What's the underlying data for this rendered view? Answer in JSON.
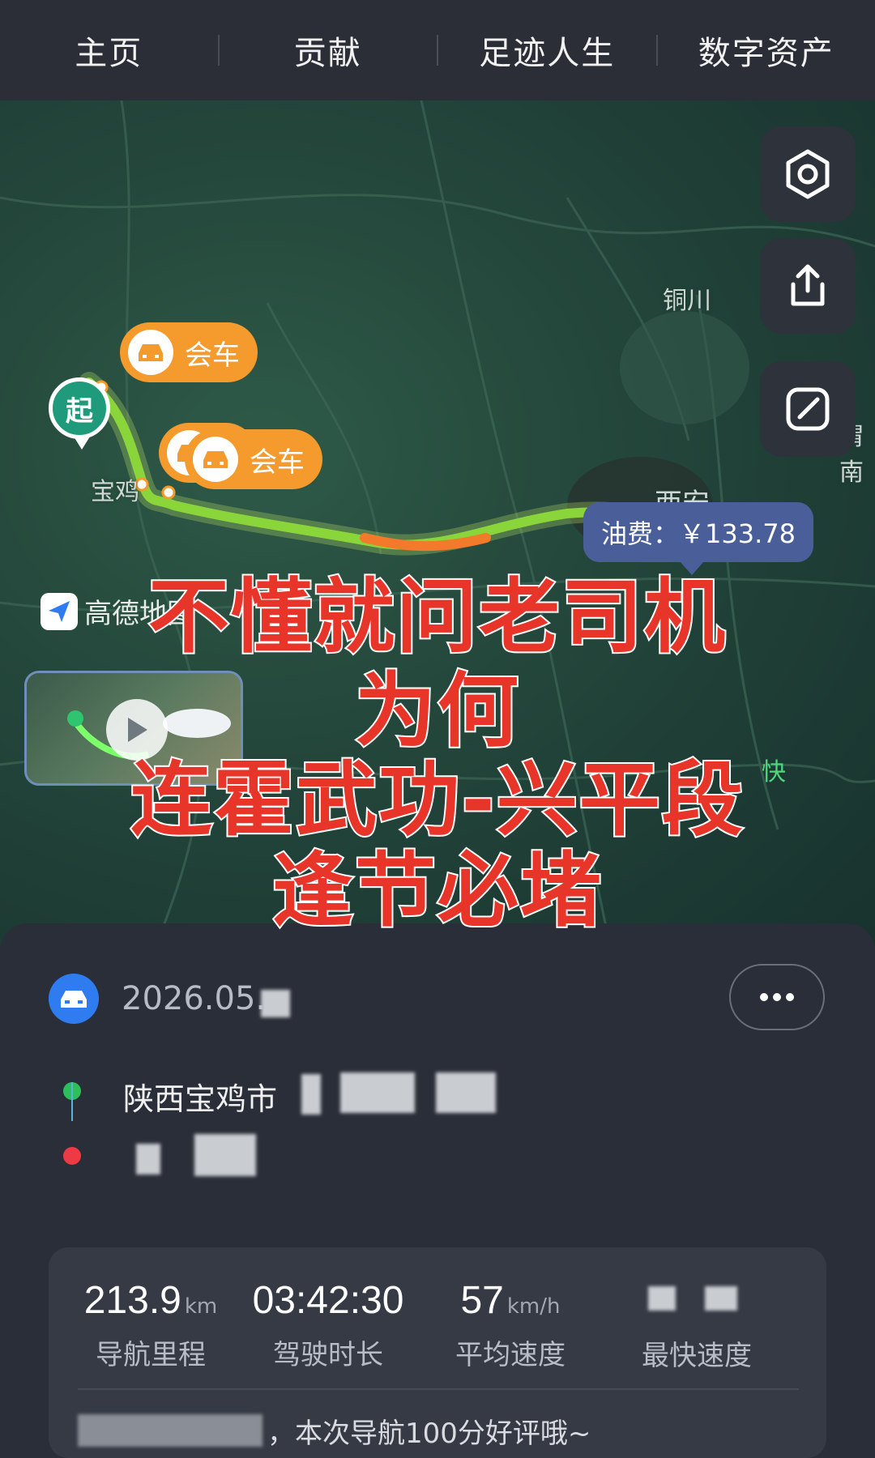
{
  "topnav": {
    "tabs": [
      "主页",
      "贡献",
      "足迹人生",
      "数字资产"
    ]
  },
  "map": {
    "cities": {
      "tongchuan": "铜川",
      "baoji": "宝鸡",
      "xian": "西安",
      "weinan_partial": "渭南"
    },
    "start_label": "起",
    "meet_tags": [
      "会车",
      "会车"
    ],
    "fuel_text": "油费：￥133.78",
    "brand": "高德地图",
    "fast_label": "快"
  },
  "caption": {
    "line1": "不懂就问老司机",
    "line2": "为何",
    "line3": "连霍武功-兴平段",
    "line4": "逢节必堵"
  },
  "trip": {
    "date": "2026.05.",
    "start_address": "陕西宝鸡市"
  },
  "stats": {
    "distance": {
      "value": "213.9",
      "unit": "km",
      "label": "导航里程"
    },
    "duration": {
      "value": "03:42:30",
      "unit": "",
      "label": "驾驶时长"
    },
    "avg_speed": {
      "value": "57",
      "unit": "km/h",
      "label": "平均速度"
    },
    "max_speed": {
      "value": "",
      "unit": "",
      "label": "最快速度"
    },
    "comment": "，本次导航100分好评哦~"
  },
  "colors": {
    "start_green": "#1f9a7a",
    "meet_orange": "#f59a2c",
    "fuel_blue": "#4a5f9a",
    "caption_red": "#e8352a",
    "nav_blue": "#2f7bf0"
  }
}
